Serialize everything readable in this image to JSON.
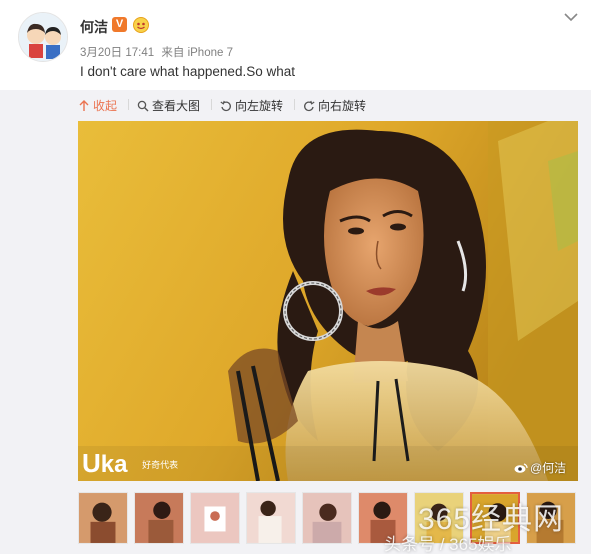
{
  "post": {
    "username": "何洁",
    "verified_badge": "V",
    "date": "3月20日 17:41",
    "source": "来自 iPhone 7",
    "text": "I don't care what happened.So what"
  },
  "toolbar": {
    "collapse": "收起",
    "view_large": "查看大图",
    "rotate_left": "向左旋转",
    "rotate_right": "向右旋转"
  },
  "photo": {
    "watermark": "@何洁",
    "magazine_logo": "ka",
    "magazine_caption": "好奇代表"
  },
  "thumbnails": {
    "count": 9,
    "selected_index": 7
  },
  "site_watermark": {
    "main": "365经典网",
    "sub": "头条号 / 365娱乐"
  },
  "colors": {
    "accent": "#eb7350",
    "badge": "#f0792b",
    "photo_yellow": "#e8b52a"
  }
}
